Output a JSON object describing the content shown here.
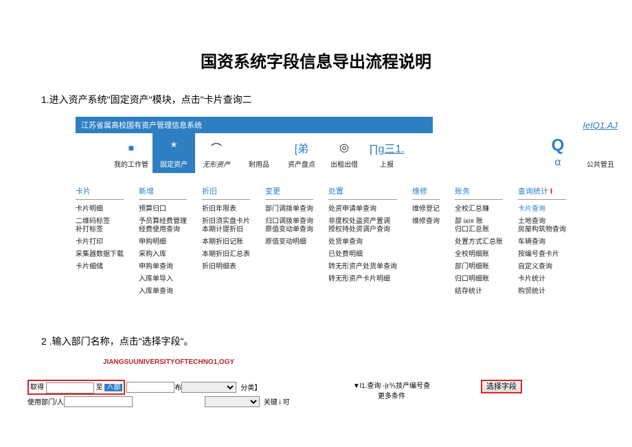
{
  "pageTitle": "国资系统字段信息导出流程说明",
  "step1": "1.进入资产系统\"固定资产\"模块，点击\"卡片查询二",
  "step2": "2  .输入部门名称，点击\"选择字段\"。",
  "appHeader": {
    "title": "江苏省属高校国有资产管理信息系统",
    "right": "IeIQ1.AJ"
  },
  "toolbar": [
    {
      "icon": "■",
      "label": "我的工作管",
      "color": "#2E7FC1"
    },
    {
      "icon": "*",
      "label": "固定资产",
      "active": true
    },
    {
      "icon": "⌒",
      "label": "无形资产",
      "italic": true
    },
    {
      "icon": "",
      "label": "耐用品"
    },
    {
      "icon": "[弟",
      "label": "资产盘点",
      "color": "#2E7FC1"
    },
    {
      "icon": "◎",
      "label": "出租出借"
    },
    {
      "icon": "∏g三1.",
      "label": "上报",
      "color": "#2E7FC1",
      "underline": true
    },
    {
      "icon": "Q",
      "label": "α",
      "color": "#2E7FC1"
    },
    {
      "icon": "",
      "label": "公共管丑"
    }
  ],
  "menu": {
    "cols": [
      {
        "header": "卡片",
        "items": [
          "卡片明细",
          "二维码标签\n补打标签",
          "卡片打印",
          "采集器数据下载",
          "卡片细储"
        ]
      },
      {
        "header": "新增",
        "items": [
          "预算归口",
          "予员算经费管理\n经费使用查询",
          "申购明细",
          "采购入库",
          "申购单查询",
          "入库单导入",
          "入库单查询"
        ]
      },
      {
        "header": "折旧",
        "items": [
          "折旧年限表",
          "折旧须实盘卡片\n本期计提折旧",
          "本期折旧记账",
          "本期折旧汇总表",
          "折旧明细表"
        ]
      },
      {
        "header": "变更",
        "items": [
          "部门调拨单查询",
          "归口调拨单查询\n原值变动单查询",
          "原值变动明细"
        ]
      },
      {
        "header": "处置",
        "items": [
          "处资申请单查询",
          "非度权处盗资产置调\n授权持处资调户查询",
          "处货单查询",
          "已处费明细",
          "转无形资产处货单查询",
          "转无形资产卡片明细"
        ]
      },
      {
        "header": "维修",
        "items": [
          "维修登记",
          "维修查询"
        ]
      },
      {
        "header": "账务",
        "items": [
          "全校汇总赚",
          "部 ixi≡ 账\n归口汇总账",
          "处置方式汇总账",
          "全校明细账",
          "部门明细账",
          "归口明细账",
          "结存统计"
        ]
      },
      {
        "header": "查询统计",
        "mark": "I",
        "items": [
          "卡片查询",
          "土地查询\n房屋构筑物查询",
          "车辆查询",
          "按编号查卡片",
          "自定义查询",
          "卡片统计",
          "购贸统计"
        ],
        "highlight": true
      }
    ]
  },
  "s2": {
    "logo": "JIANGSUUNIVERSITYOFTECHNO1,OGY",
    "row": {
      "label1a": "取得",
      "label1b": "至",
      "label1c": "布",
      "label1d": "分类",
      "label2a": "使用部门/人",
      "label2b": "关键 i 可",
      "mid1": "▼l1.查询 -|r⅗技产编号查",
      "mid2": "更多条件",
      "btn": "选择字段"
    }
  }
}
